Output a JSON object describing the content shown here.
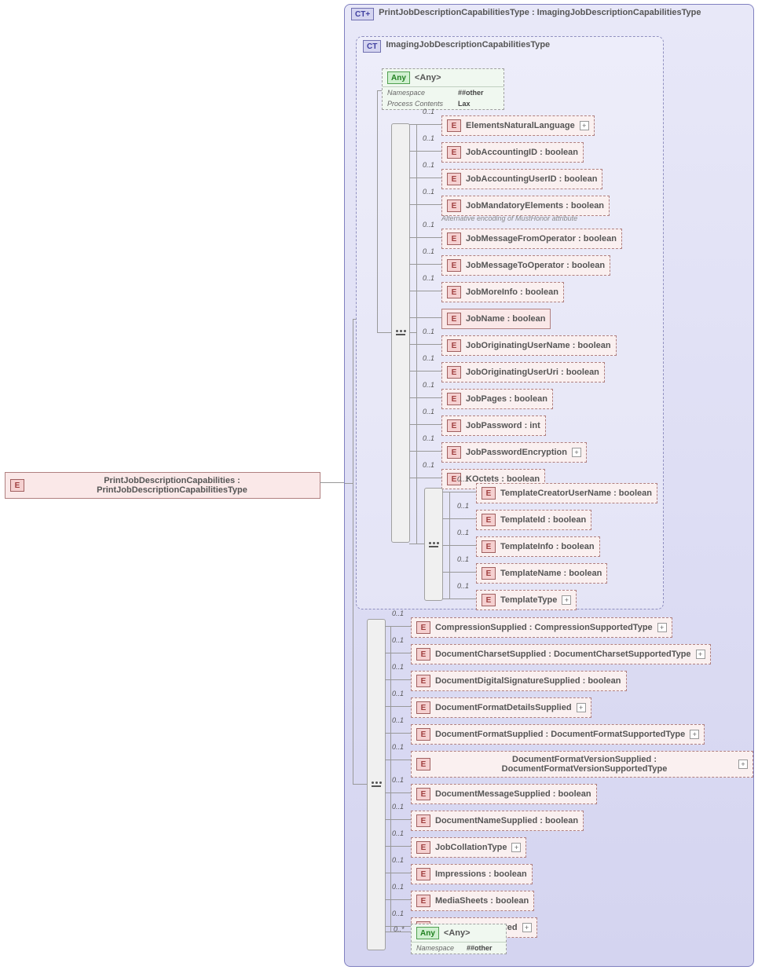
{
  "root": {
    "label": "PrintJobDescriptionCapabilities : PrintJobDescriptionCapabilitiesType"
  },
  "ct_outer": {
    "badge": "CT+",
    "title": "PrintJobDescriptionCapabilitiesType : ImagingJobDescriptionCapabilitiesType"
  },
  "ct_inner": {
    "badge": "CT",
    "title": "ImagingJobDescriptionCapabilitiesType"
  },
  "any1": {
    "badge": "Any",
    "label": "<Any>",
    "ns_k": "Namespace",
    "ns_v": "##other",
    "pc_k": "Process Contents",
    "pc_v": "Lax"
  },
  "inner_elems": [
    {
      "card": "0..1",
      "label": "ElementsNaturalLanguage",
      "exp": true
    },
    {
      "card": "0..1",
      "label": "JobAccountingID : boolean"
    },
    {
      "card": "0..1",
      "label": "JobAccountingUserID : boolean"
    },
    {
      "card": "0..1",
      "label": "JobMandatoryElements : boolean",
      "ann": "Alternative encoding of MustHonor attribute",
      "wide": true
    },
    {
      "card": "0..1",
      "label": "JobMessageFromOperator : boolean"
    },
    {
      "card": "0..1",
      "label": "JobMessageToOperator : boolean"
    },
    {
      "card": "0..1",
      "label": "JobMoreInfo : boolean"
    },
    {
      "card": "",
      "label": "JobName : boolean",
      "solid": true
    },
    {
      "card": "0..1",
      "label": "JobOriginatingUserName : boolean"
    },
    {
      "card": "0..1",
      "label": "JobOriginatingUserUri : boolean"
    },
    {
      "card": "0..1",
      "label": "JobPages : boolean"
    },
    {
      "card": "0..1",
      "label": "JobPassword : int"
    },
    {
      "card": "0..1",
      "label": "JobPasswordEncryption",
      "exp": true
    },
    {
      "card": "0..1",
      "label": "KOctets  : boolean"
    }
  ],
  "tpl_elems": [
    {
      "card": "0..1",
      "label": "TemplateCreatorUserName : boolean"
    },
    {
      "card": "0..1",
      "label": "TemplateId : boolean"
    },
    {
      "card": "0..1",
      "label": "TemplateInfo : boolean"
    },
    {
      "card": "0..1",
      "label": "TemplateName : boolean"
    },
    {
      "card": "0..1",
      "label": "TemplateType",
      "exp": true
    }
  ],
  "outer_elems": [
    {
      "card": "0..1",
      "label": "CompressionSupplied : CompressionSupportedType",
      "exp": true
    },
    {
      "card": "0..1",
      "label": "DocumentCharsetSupplied : DocumentCharsetSupportedType",
      "exp": true
    },
    {
      "card": "0..1",
      "label": "DocumentDigitalSignatureSupplied : boolean"
    },
    {
      "card": "0..1",
      "label": "DocumentFormatDetailsSupplied",
      "exp": true
    },
    {
      "card": "0..1",
      "label": "DocumentFormatSupplied : DocumentFormatSupportedType",
      "exp": true
    },
    {
      "card": "0..1",
      "label": "DocumentFormatVersionSupplied : DocumentFormatVersionSupportedType",
      "exp": true,
      "tall": true
    },
    {
      "card": "0..1",
      "label": "DocumentMessageSupplied : boolean"
    },
    {
      "card": "0..1",
      "label": "DocumentNameSupplied : boolean"
    },
    {
      "card": "0..1",
      "label": "JobCollationType",
      "exp": true
    },
    {
      "card": "0..1",
      "label": "Impressions : boolean"
    },
    {
      "card": "0..1",
      "label": "MediaSheets : boolean"
    },
    {
      "card": "0..1",
      "label": "PageOrderReceived",
      "exp": true
    }
  ],
  "any2": {
    "card": "0..*",
    "badge": "Any",
    "label": "<Any>",
    "ns_k": "Namespace",
    "ns_v": "##other"
  }
}
